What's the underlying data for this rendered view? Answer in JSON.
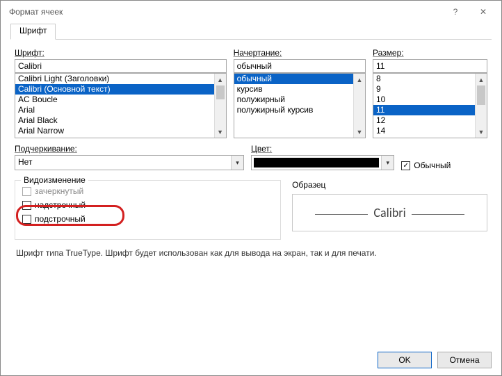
{
  "window": {
    "title": "Формат ячеек"
  },
  "tabs": {
    "font": "Шрифт"
  },
  "labels": {
    "font": "Шрифт:",
    "style": "Начертание:",
    "size": "Размер:",
    "underline": "Подчеркивание:",
    "color": "Цвет:",
    "normalFont": "Обычный",
    "effects": "Видоизменение",
    "strike": "зачеркнутый",
    "superscript": "надстрочный",
    "subscript": "подстрочный",
    "preview": "Образец"
  },
  "font": {
    "value": "Calibri",
    "items": [
      {
        "label": "Calibri Light (Заголовки)",
        "selected": false
      },
      {
        "label": "Calibri (Основной текст)",
        "selected": true
      },
      {
        "label": "AC Boucle",
        "selected": false
      },
      {
        "label": "Arial",
        "selected": false
      },
      {
        "label": "Arial Black",
        "selected": false
      },
      {
        "label": "Arial Narrow",
        "selected": false
      }
    ]
  },
  "style": {
    "value": "обычный",
    "items": [
      {
        "label": "обычный",
        "selected": true
      },
      {
        "label": "курсив",
        "selected": false
      },
      {
        "label": "полужирный",
        "selected": false
      },
      {
        "label": "полужирный курсив",
        "selected": false
      }
    ]
  },
  "size": {
    "value": "11",
    "items": [
      {
        "label": "8",
        "selected": false
      },
      {
        "label": "9",
        "selected": false
      },
      {
        "label": "10",
        "selected": false
      },
      {
        "label": "11",
        "selected": true
      },
      {
        "label": "12",
        "selected": false
      },
      {
        "label": "14",
        "selected": false
      }
    ]
  },
  "underline": {
    "value": "Нет"
  },
  "color": {
    "value": "#000000"
  },
  "normalFontChecked": true,
  "effects": {
    "strike": false,
    "superscript": false,
    "subscript": false,
    "strikeDisabled": true
  },
  "preview": {
    "text": "Calibri"
  },
  "description": "Шрифт типа TrueType. Шрифт будет использован как для вывода на экран, так и для печати.",
  "buttons": {
    "ok": "OK",
    "cancel": "Отмена"
  }
}
